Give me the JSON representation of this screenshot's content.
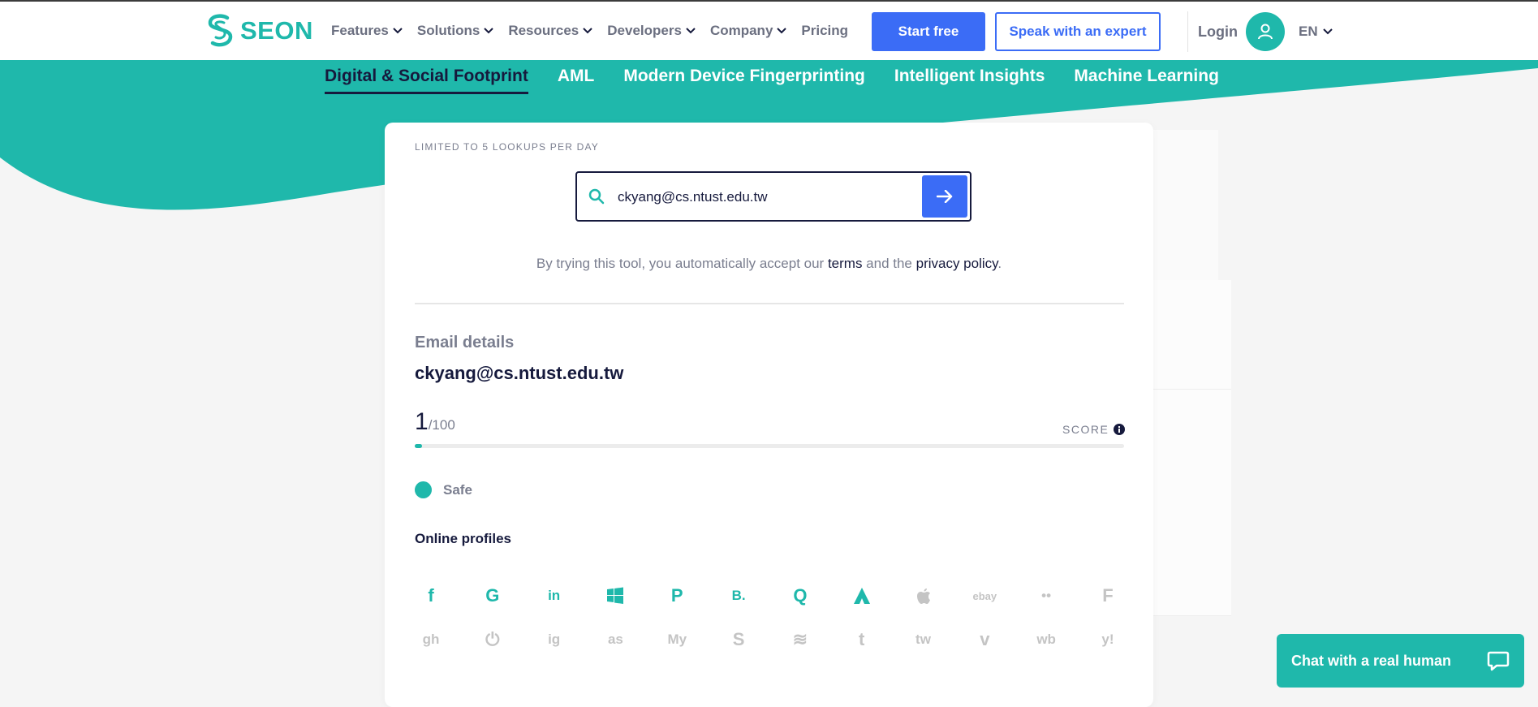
{
  "brand": {
    "name": "SEON"
  },
  "nav": {
    "items": [
      {
        "label": "Features",
        "has_dropdown": true
      },
      {
        "label": "Solutions",
        "has_dropdown": true
      },
      {
        "label": "Resources",
        "has_dropdown": true
      },
      {
        "label": "Developers",
        "has_dropdown": true
      },
      {
        "label": "Company",
        "has_dropdown": true
      },
      {
        "label": "Pricing",
        "has_dropdown": false
      }
    ],
    "start_free": "Start free",
    "speak_expert": "Speak with an expert",
    "login": "Login",
    "language": "EN"
  },
  "tabs": [
    {
      "label": "Digital & Social Footprint",
      "active": true
    },
    {
      "label": "AML",
      "active": false
    },
    {
      "label": "Modern Device Fingerprinting",
      "active": false
    },
    {
      "label": "Intelligent Insights",
      "active": false
    },
    {
      "label": "Machine Learning",
      "active": false
    }
  ],
  "tool": {
    "limit_note": "LIMITED TO 5 LOOKUPS PER DAY",
    "search_value": "ckyang@cs.ntust.edu.tw",
    "terms_prefix": "By trying this tool, you automatically accept our ",
    "terms_link": "terms",
    "terms_mid": " and the ",
    "privacy_link": "privacy policy",
    "terms_suffix": "."
  },
  "email": {
    "label": "Email details",
    "value": "ckyang@cs.ntust.edu.tw",
    "score": "1",
    "score_max": "/100",
    "score_fraction": 0.01,
    "score_label": "SCORE",
    "status": "Safe"
  },
  "profiles": {
    "title": "Online profiles",
    "rows": [
      [
        {
          "name": "facebook-icon",
          "glyph": "f",
          "active": true
        },
        {
          "name": "google-icon",
          "glyph": "G",
          "active": true
        },
        {
          "name": "linkedin-icon",
          "glyph": "in",
          "active": true
        },
        {
          "name": "microsoft-icon",
          "glyph": "win",
          "active": true
        },
        {
          "name": "pinterest-icon",
          "glyph": "P",
          "active": true
        },
        {
          "name": "booking-icon",
          "glyph": "B.",
          "active": true
        },
        {
          "name": "quora-icon",
          "glyph": "Q",
          "active": true
        },
        {
          "name": "atlassian-icon",
          "glyph": "A",
          "active": true
        },
        {
          "name": "apple-icon",
          "glyph": "",
          "active": false
        },
        {
          "name": "ebay-icon",
          "glyph": "ebay",
          "active": false
        },
        {
          "name": "flickr-icon",
          "glyph": "••",
          "active": false
        },
        {
          "name": "foursquare-icon",
          "glyph": "F",
          "active": false
        }
      ],
      [
        {
          "name": "github-icon",
          "glyph": "gh",
          "active": false
        },
        {
          "name": "power-icon",
          "glyph": "⏻",
          "active": false
        },
        {
          "name": "instagram-icon",
          "glyph": "ig",
          "active": false
        },
        {
          "name": "lastfm-icon",
          "glyph": "as",
          "active": false
        },
        {
          "name": "myspace-icon",
          "glyph": "My",
          "active": false
        },
        {
          "name": "skype-icon",
          "glyph": "S",
          "active": false
        },
        {
          "name": "spotify-icon",
          "glyph": "≋",
          "active": false
        },
        {
          "name": "tumblr-icon",
          "glyph": "t",
          "active": false
        },
        {
          "name": "twitter-icon",
          "glyph": "tw",
          "active": false
        },
        {
          "name": "vimeo-icon",
          "glyph": "v",
          "active": false
        },
        {
          "name": "weibo-icon",
          "glyph": "wb",
          "active": false
        },
        {
          "name": "yahoo-icon",
          "glyph": "y!",
          "active": false
        }
      ]
    ]
  },
  "chat": {
    "label": "Chat with a real human"
  },
  "colors": {
    "teal": "#1fb8ab",
    "blue": "#3b6cf6",
    "navy": "#161a3d",
    "muted": "#7a7e8f"
  }
}
